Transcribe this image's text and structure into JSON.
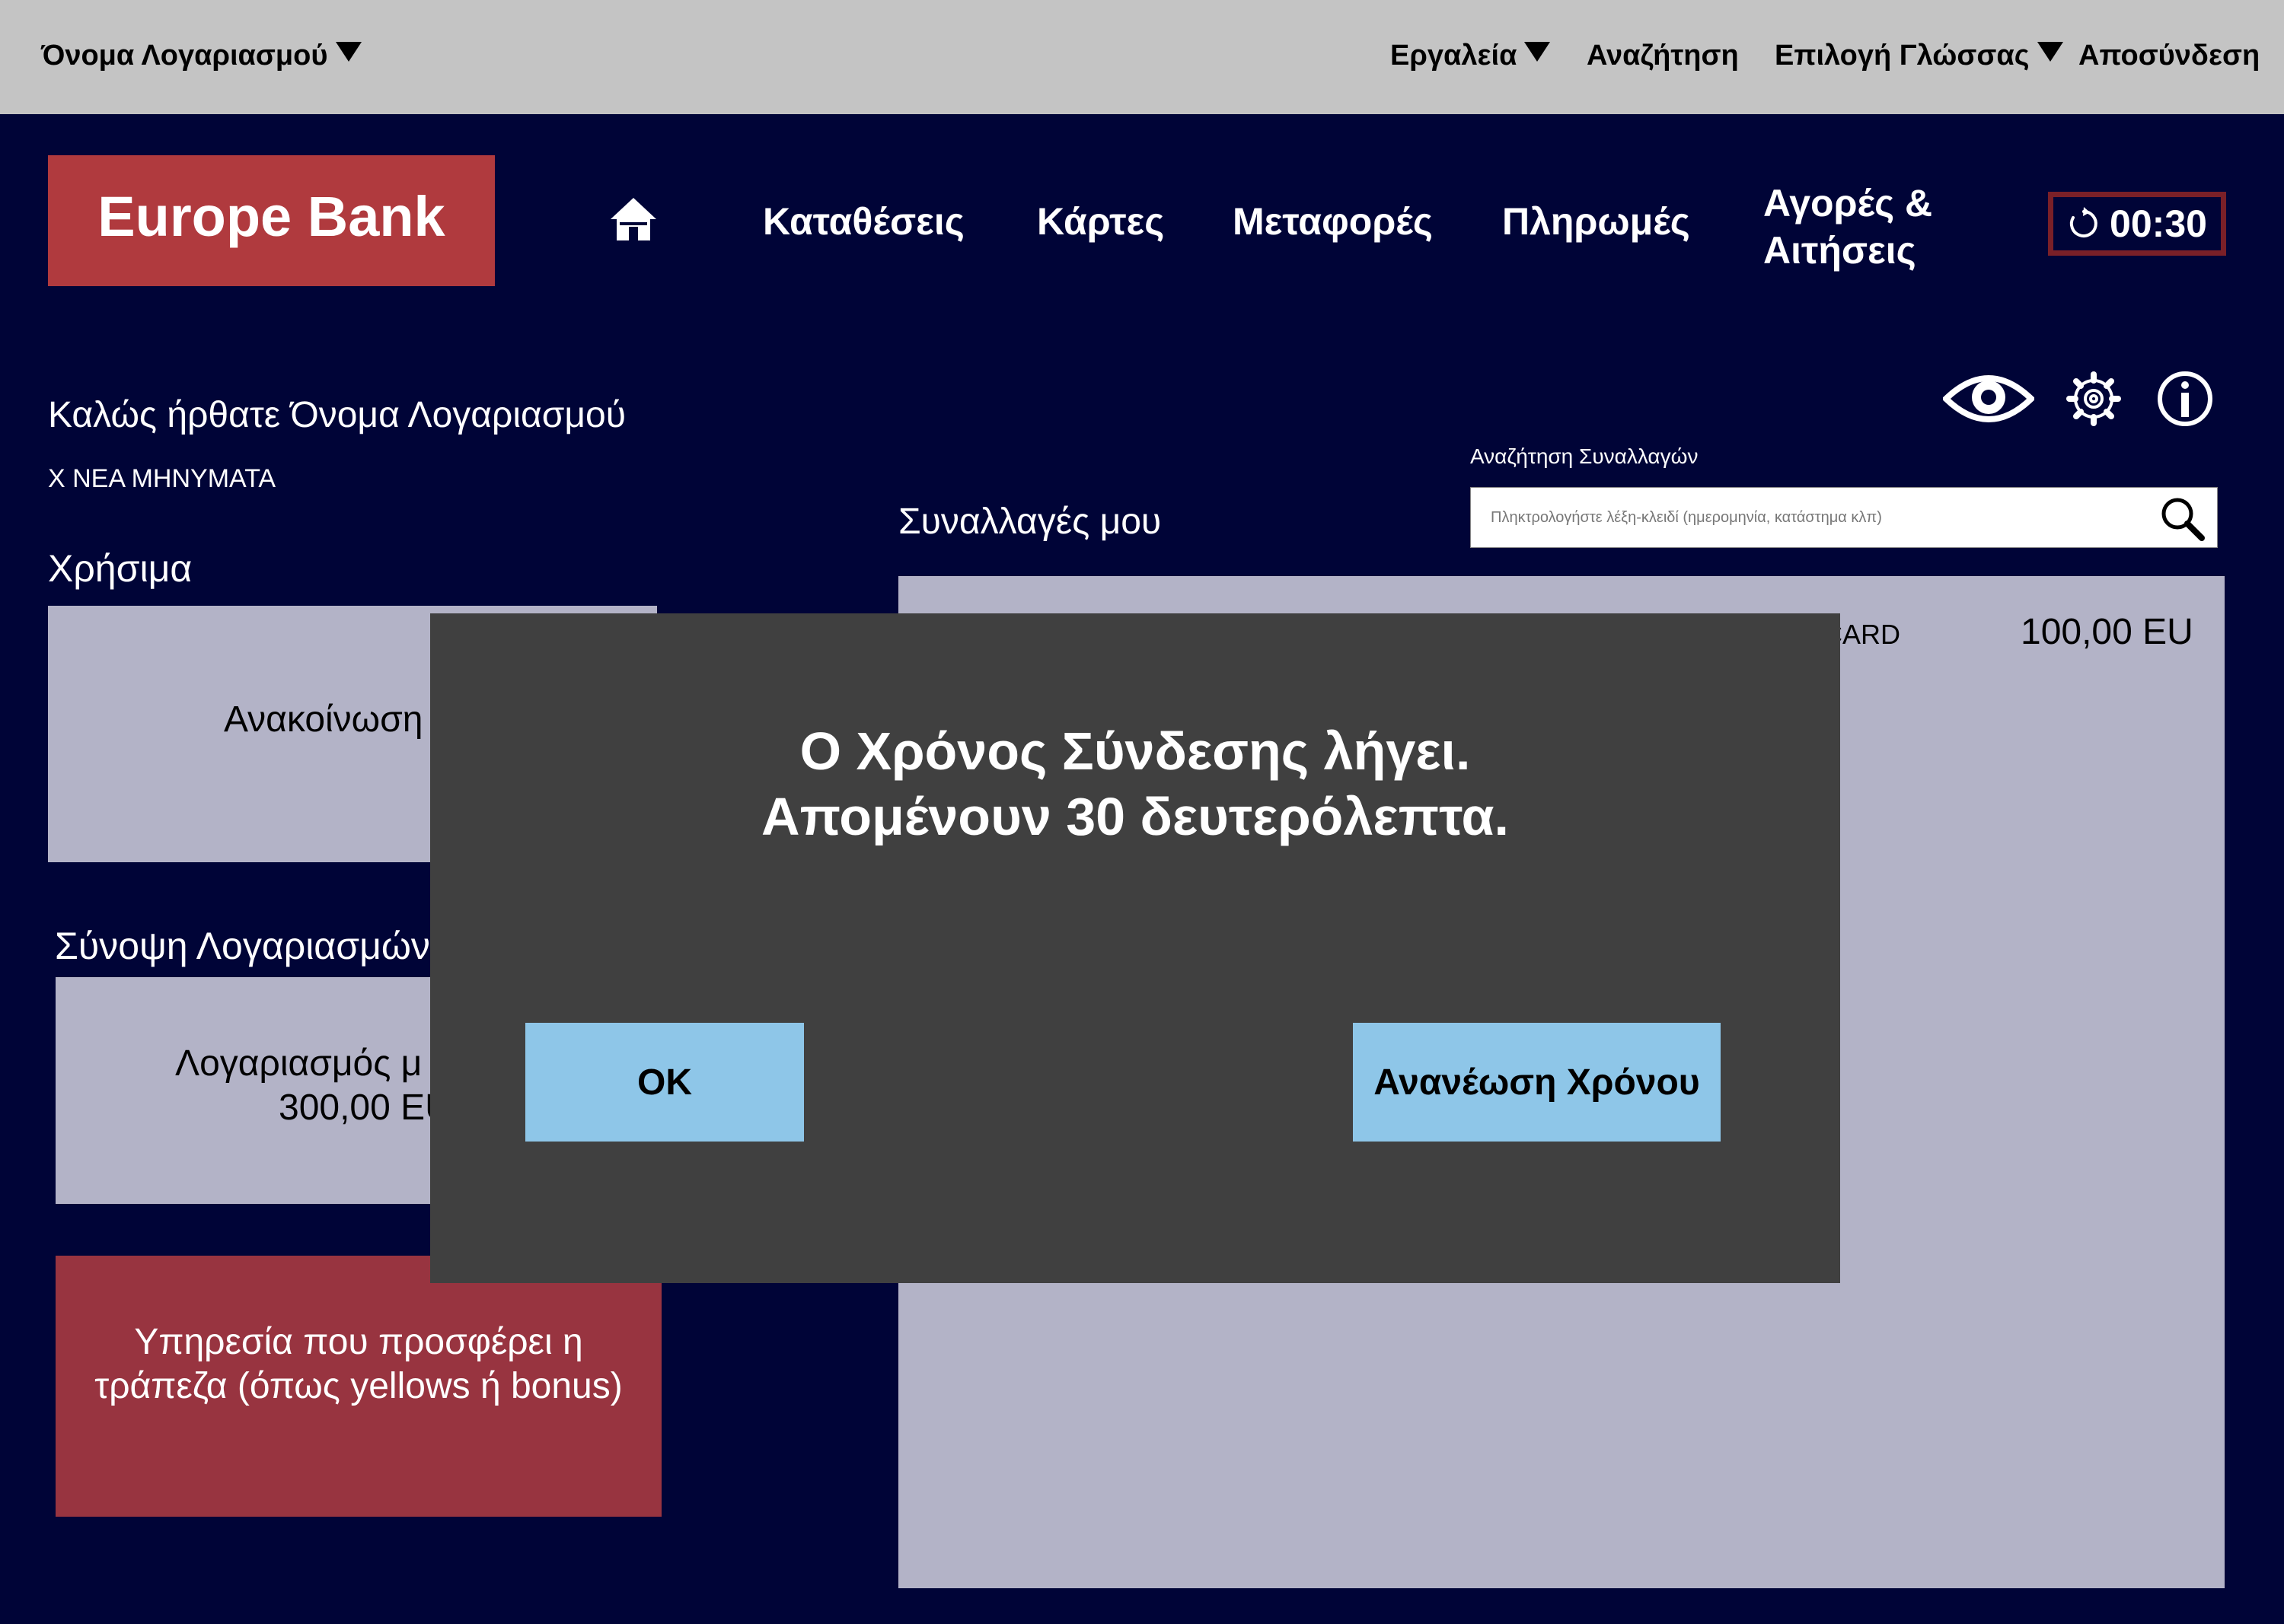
{
  "topbar": {
    "account_menu": "Όνομα Λογαριασμού",
    "tools": "Εργαλεία",
    "search": "Αναζήτηση",
    "language": "Επιλογή Γλώσσας",
    "logout": "Αποσύνδεση"
  },
  "brand": {
    "name": "Europe Bank",
    "color": "#b03a3e"
  },
  "nav": {
    "home_icon": "home-icon",
    "deposits": "Καταθέσεις",
    "cards": "Κάρτες",
    "transfers": "Μεταφορές",
    "payments": "Πληρωμές",
    "purchases_line1": "Αγορές &",
    "purchases_line2": "Αιτήσεις"
  },
  "session": {
    "timer": "00:30",
    "icon": "refresh-icon"
  },
  "welcome": {
    "greeting": "Καλώς ήρθατε Όνομα Λογαριασμού",
    "messages": "Χ ΝΕΑ ΜΗΝΥΜΑΤΑ"
  },
  "useful": {
    "title": "Χρήσιμα",
    "announcement": "Ανακοίνωση"
  },
  "accounts": {
    "title": "Σύνοψη Λογαριασμών",
    "account_line1": "Λογαριασμός μ",
    "account_line2": "300,00 EU"
  },
  "promo": {
    "text": "Υπηρεσία που προσφέρει η τράπεζα (όπως yellows ή bonus)"
  },
  "tools": {
    "icons": [
      "eye-icon",
      "gear-icon",
      "info-icon"
    ]
  },
  "transactions": {
    "title": "Συναλλαγές μου",
    "search_label": "Αναζήτηση Συναλλαγών",
    "search_placeholder": "Πληκτρολογήστε λέξη-κλειδί (ημερομηνία, κατάστημα κλπ)",
    "rows": [
      {
        "type": "CARD",
        "amount": "100,00 EU"
      }
    ]
  },
  "modal": {
    "line1": "Ο Χρόνος Σύνδεσης λήγει.",
    "line2": "Απομένουν 30 δευτερόλεπτα.",
    "ok": "OK",
    "renew": "Ανανέωση Χρόνου"
  },
  "colors": {
    "background": "#000437",
    "topbar": "#c4c4c4",
    "panel": "#b3b3c7",
    "promo": "#983440",
    "modal": "#404040",
    "button": "#8ec6e8",
    "timer_border": "#7a2028"
  }
}
